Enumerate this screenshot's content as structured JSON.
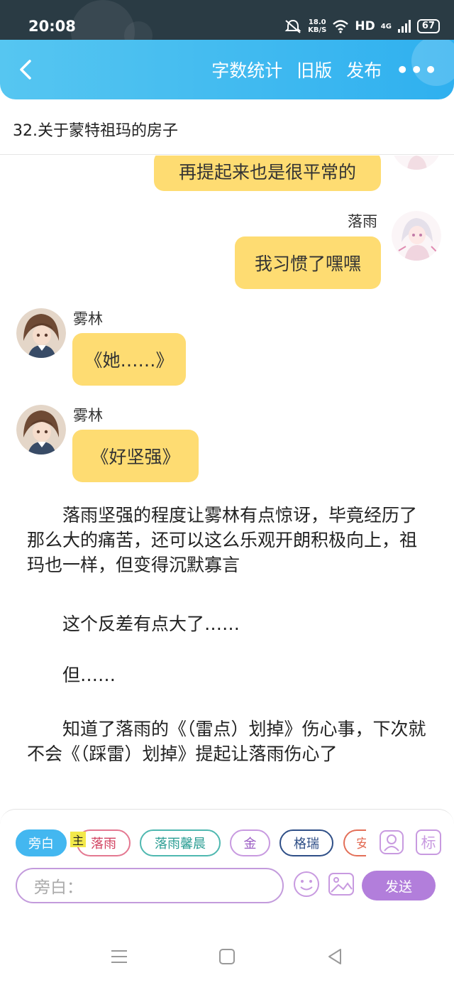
{
  "status_bar": {
    "time": "20:08",
    "speed_value": "18.0",
    "speed_unit": "KB/S",
    "network": "HD",
    "network_gen": "4G",
    "battery": "67"
  },
  "header": {
    "back_icon": "chevron-left-icon",
    "actions": [
      "字数统计",
      "旧版",
      "发布"
    ],
    "more": "•••"
  },
  "chapter_title": "32.关于蒙特祖玛的房子",
  "messages": [
    {
      "type": "bubble",
      "side": "right",
      "text": "再提起来也是很平常的"
    },
    {
      "type": "bubble",
      "side": "right",
      "speaker": "落雨",
      "text": "我习惯了嘿嘿"
    },
    {
      "type": "bubble",
      "side": "left",
      "speaker": "雾林",
      "text": "《她……》"
    },
    {
      "type": "bubble",
      "side": "left",
      "speaker": "雾林",
      "text": "《好坚强》"
    }
  ],
  "narration": [
    "　　落雨坚强的程度让雾林有点惊讶，毕竟经历了那么大的痛苦，还可以这么乐观开朗积极向上，祖玛也一样，但变得沉默寡言",
    "　　这个反差有点大了……",
    "　　但……",
    "　　知道了落雨的《（雷点）划掉》伤心事，下次就不会《（踩雷）划掉》提起让落雨伤心了"
  ],
  "composer": {
    "chips": [
      "旁白",
      "落雨",
      "落雨馨晨",
      "金",
      "格瑞",
      "安"
    ],
    "host_tag": "主",
    "mark_label": "标",
    "input_placeholder": "旁白：",
    "send_label": "发送"
  },
  "colors": {
    "header": "#3bb9f0",
    "bubble": "#fedc72",
    "send": "#b27edb",
    "active_chip": "#43b7f0"
  }
}
